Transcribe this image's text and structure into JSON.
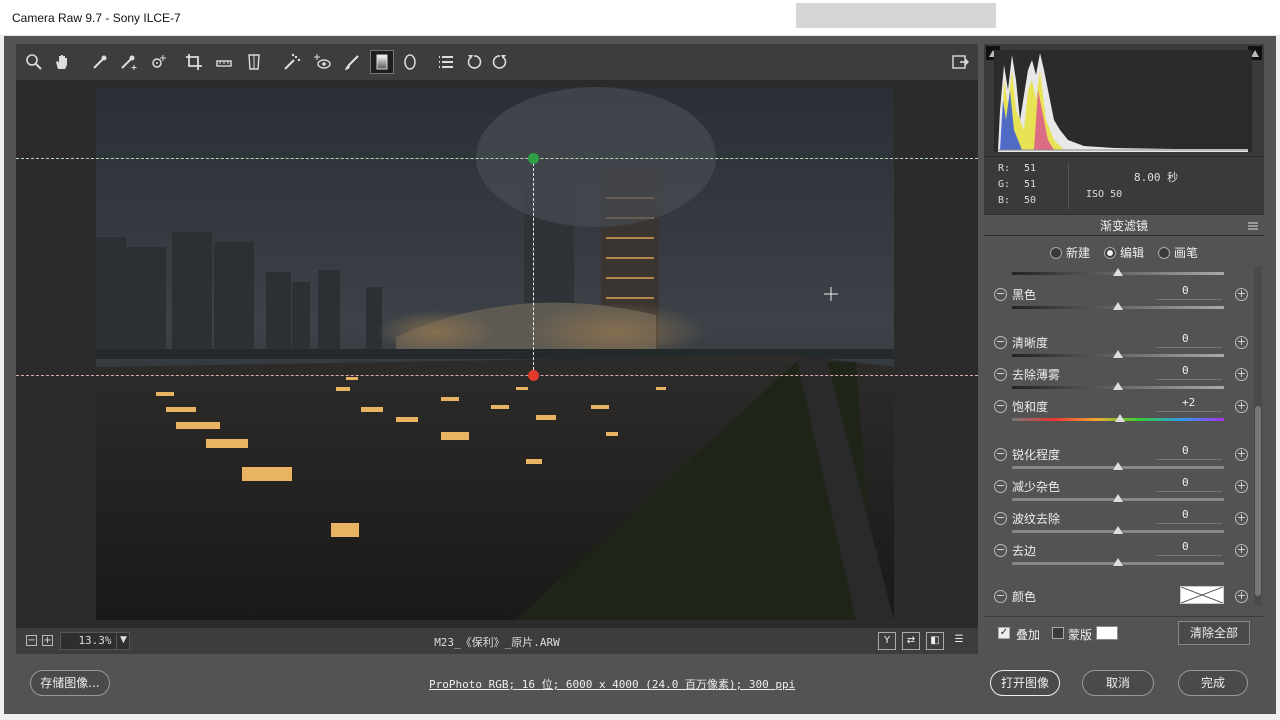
{
  "window": {
    "title": "Camera Raw 9.7 -  Sony ILCE-7"
  },
  "toolbar": {
    "tools": [
      {
        "name": "zoom-tool",
        "icon": "zoom-icon"
      },
      {
        "name": "hand-tool",
        "icon": "hand-icon"
      },
      {
        "name": "white-balance-tool",
        "icon": "eyedropper-icon"
      },
      {
        "name": "color-sampler-tool",
        "icon": "color-sampler-icon"
      },
      {
        "name": "targeted-adjustment-tool",
        "icon": "target-adjust-icon"
      },
      {
        "name": "crop-tool",
        "icon": "crop-icon"
      },
      {
        "name": "straighten-tool",
        "icon": "straighten-icon"
      },
      {
        "name": "transform-tool",
        "icon": "transform-icon"
      },
      {
        "name": "spot-removal-tool",
        "icon": "spot-removal-icon"
      },
      {
        "name": "red-eye-tool",
        "icon": "red-eye-icon"
      },
      {
        "name": "adjustment-brush-tool",
        "icon": "brush-icon"
      },
      {
        "name": "graduated-filter-tool",
        "icon": "graduated-filter-icon",
        "active": true
      },
      {
        "name": "radial-filter-tool",
        "icon": "radial-filter-icon"
      },
      {
        "name": "preferences-tool",
        "icon": "list-icon"
      },
      {
        "name": "rotate-ccw-tool",
        "icon": "rotate-ccw-icon"
      },
      {
        "name": "rotate-cw-tool",
        "icon": "rotate-cw-icon"
      }
    ],
    "fullscreen_icon": "fullscreen-icon"
  },
  "canvas": {
    "zoom": "13.3%",
    "filename": "M23_《保利》_原片.ARW",
    "view_buttons": [
      "Y",
      "⇄",
      "◧",
      "☰"
    ]
  },
  "footer": {
    "save_label": "存储图像...",
    "workflow": "ProPhoto RGB; 16 位; 6000 x 4000 (24.0 百万像素); 300 ppi",
    "open_label": "打开图像",
    "cancel_label": "取消",
    "done_label": "完成"
  },
  "info": {
    "r_label": "R:",
    "r": "51",
    "g_label": "G:",
    "g": "51",
    "b_label": "B:",
    "b": "50",
    "shutter": "8.00 秒",
    "iso": "ISO 50"
  },
  "panel": {
    "title": "渐变滤镜",
    "modes": [
      {
        "label": "新建",
        "selected": false
      },
      {
        "label": "编辑",
        "selected": true
      },
      {
        "label": "画笔",
        "selected": false
      }
    ],
    "sliders": [
      {
        "label": "黑色",
        "value": "0",
        "pos": 0.5
      },
      {
        "label": "清晰度",
        "value": "0",
        "pos": 0.5
      },
      {
        "label": "去除薄雾",
        "value": "0",
        "pos": 0.5
      },
      {
        "label": "饱和度",
        "value": "+2",
        "pos": 0.51
      },
      {
        "label": "锐化程度",
        "value": "0",
        "pos": 0.5
      },
      {
        "label": "减少杂色",
        "value": "0",
        "pos": 0.5
      },
      {
        "label": "波纹去除",
        "value": "0",
        "pos": 0.5
      },
      {
        "label": "去边",
        "value": "0",
        "pos": 0.5
      }
    ],
    "color_label": "颜色",
    "overlay_label": "叠加",
    "overlay_checked": true,
    "mask_label": "蒙版",
    "mask_checked": false,
    "clear_all_label": "清除全部"
  }
}
